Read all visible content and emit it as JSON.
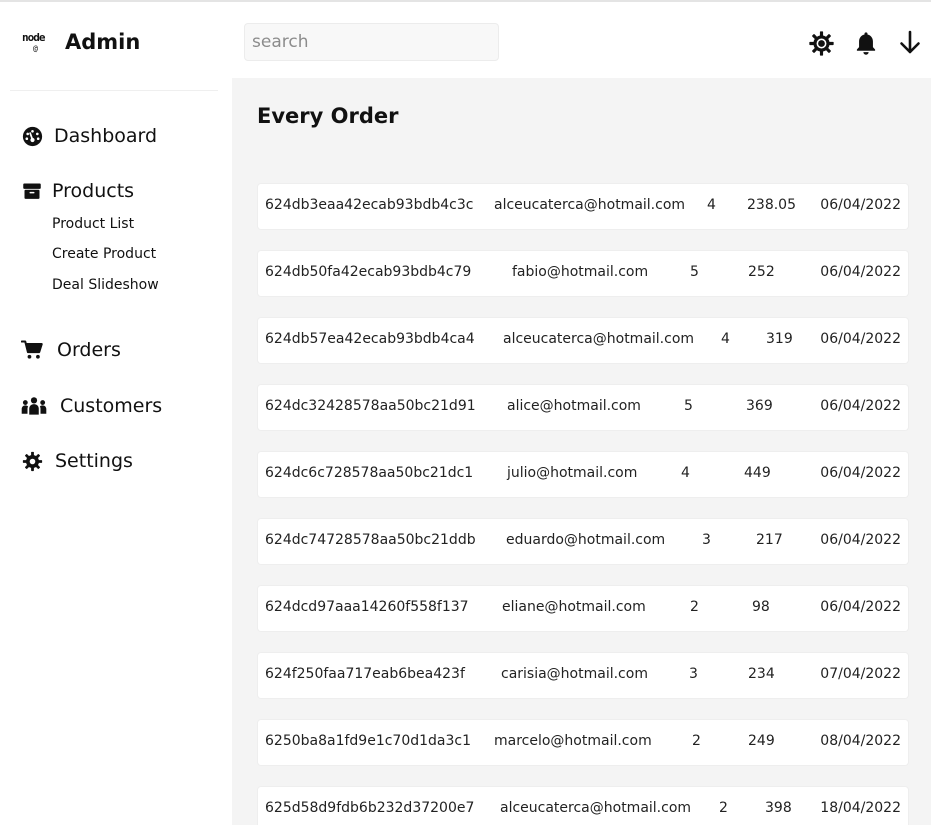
{
  "app": {
    "title": "Admin",
    "logo_text": "node",
    "logo_mark": "@"
  },
  "search": {
    "placeholder": "search",
    "value": ""
  },
  "header_icons": [
    "settings-gear-icon",
    "bell-icon",
    "arrow-down-icon"
  ],
  "sidebar": {
    "items": [
      {
        "label": "Dashboard",
        "icon": "dashboard-gauge-icon"
      },
      {
        "label": "Products",
        "icon": "box-icon"
      },
      {
        "label": "Orders",
        "icon": "cart-icon"
      },
      {
        "label": "Customers",
        "icon": "users-icon"
      },
      {
        "label": "Settings",
        "icon": "gear-icon"
      }
    ],
    "products_subitems": [
      "Product List",
      "Create Product",
      "Deal Slideshow"
    ]
  },
  "main": {
    "title": "Every Order",
    "orders": [
      {
        "id": "624db3eaa42ecab93bdb4c3c",
        "email": "alceucaterca@hotmail.com",
        "qty": "4",
        "total": "238.05",
        "date": "06/04/2022"
      },
      {
        "id": "624db50fa42ecab93bdb4c79",
        "email": "fabio@hotmail.com",
        "qty": "5",
        "total": "252",
        "date": "06/04/2022"
      },
      {
        "id": "624db57ea42ecab93bdb4ca4",
        "email": "alceucaterca@hotmail.com",
        "qty": "4",
        "total": "319",
        "date": "06/04/2022"
      },
      {
        "id": "624dc32428578aa50bc21d91",
        "email": "alice@hotmail.com",
        "qty": "5",
        "total": "369",
        "date": "06/04/2022"
      },
      {
        "id": "624dc6c728578aa50bc21dc1",
        "email": "julio@hotmail.com",
        "qty": "4",
        "total": "449",
        "date": "06/04/2022"
      },
      {
        "id": "624dc74728578aa50bc21ddb",
        "email": "eduardo@hotmail.com",
        "qty": "3",
        "total": "217",
        "date": "06/04/2022"
      },
      {
        "id": "624dcd97aaa14260f558f137",
        "email": "eliane@hotmail.com",
        "qty": "2",
        "total": "98",
        "date": "06/04/2022"
      },
      {
        "id": "624f250faa717eab6bea423f",
        "email": "carisia@hotmail.com",
        "qty": "3",
        "total": "234",
        "date": "07/04/2022"
      },
      {
        "id": "6250ba8a1fd9e1c70d1da3c1",
        "email": "marcelo@hotmail.com",
        "qty": "2",
        "total": "249",
        "date": "08/04/2022"
      },
      {
        "id": "625d58d9fdb6b232d37200e7",
        "email": "alceucaterca@hotmail.com",
        "qty": "2",
        "total": "398",
        "date": "18/04/2022"
      }
    ]
  }
}
